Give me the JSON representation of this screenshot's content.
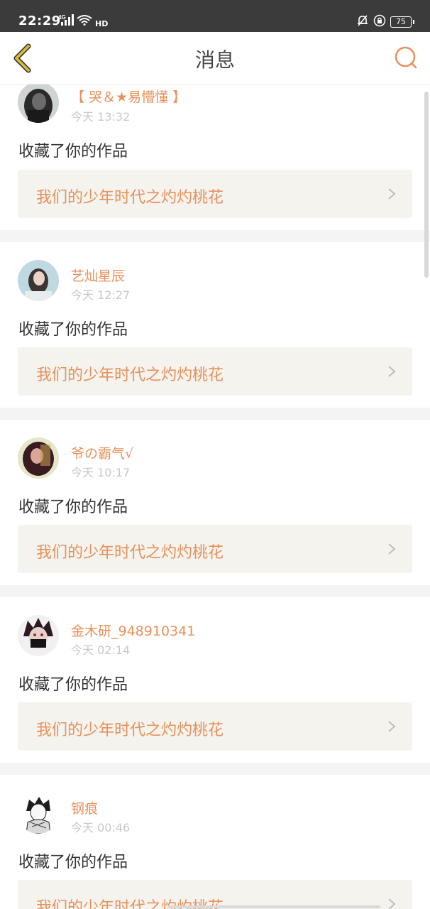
{
  "status_bar": {
    "time": "22:29",
    "network": "4G",
    "hd": "HD",
    "battery": "75"
  },
  "nav": {
    "title": "消息",
    "back_icon": "chevron-left-icon",
    "search_icon": "search-icon"
  },
  "colors": {
    "accent": "#e8915c",
    "back_arrow": "#d9b83a",
    "card_bg": "#f4f3ee",
    "separator": "#f4f4f4"
  },
  "messages": [
    {
      "username": "【 哭＆★易懵懂 】",
      "time": "今天 13:32",
      "action": "收藏了你的作品",
      "work_title": "我们的少年时代之灼灼桃花"
    },
    {
      "username": "艺灿星辰",
      "time": "今天 12:27",
      "action": "收藏了你的作品",
      "work_title": "我们的少年时代之灼灼桃花"
    },
    {
      "username": "爷の霸气√",
      "time": "今天 10:17",
      "action": "收藏了你的作品",
      "work_title": "我们的少年时代之灼灼桃花"
    },
    {
      "username": "金木研_948910341",
      "time": "今天 02:14",
      "action": "收藏了你的作品",
      "work_title": "我们的少年时代之灼灼桃花"
    },
    {
      "username": "钢痕",
      "time": "今天 00:46",
      "action": "收藏了你的作品",
      "work_title": "我们的少年时代之灼灼桃花"
    }
  ]
}
